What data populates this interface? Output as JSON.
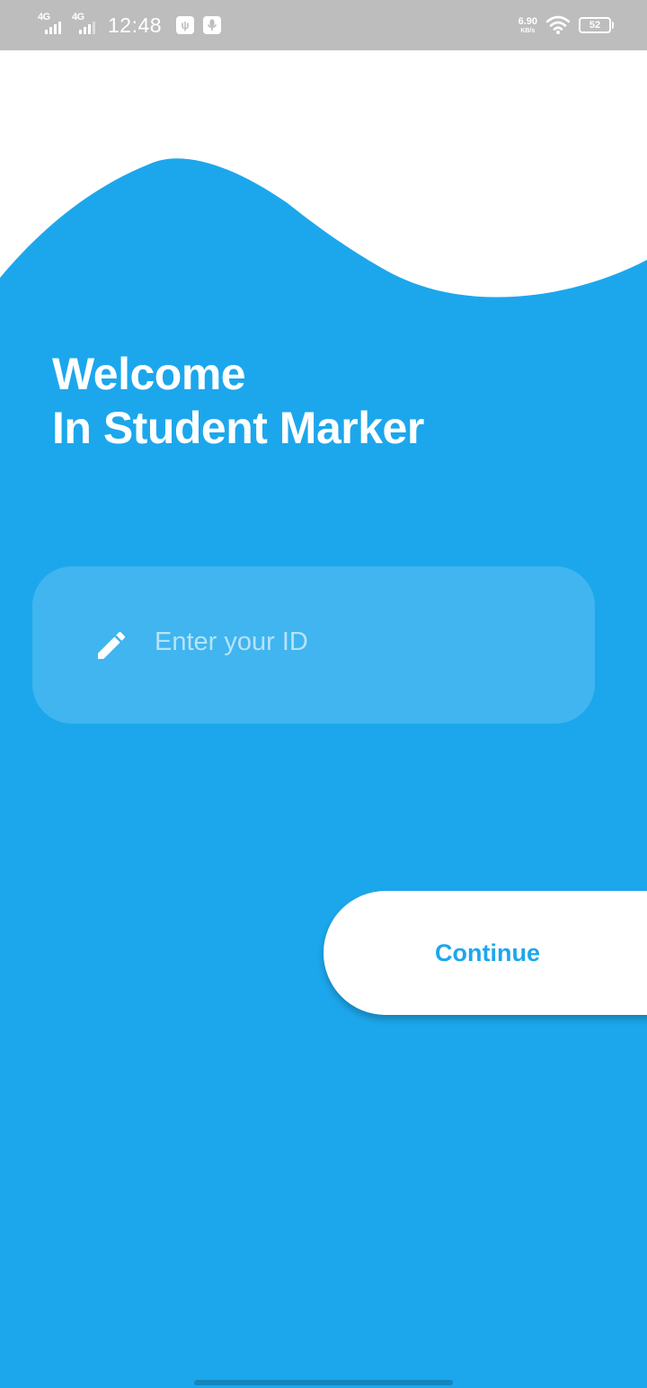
{
  "status_bar": {
    "network_1": "4G",
    "network_2": "4G",
    "time": "12:48",
    "speed_value": "6.90",
    "speed_unit": "KB/s",
    "battery": "52",
    "icons": [
      "signal-icon",
      "usb-icon",
      "mic-icon",
      "wifi-icon",
      "battery-icon"
    ]
  },
  "welcome": {
    "line1": "Welcome",
    "line2": "In Student Marker"
  },
  "id_field": {
    "placeholder": "Enter your ID",
    "value": "",
    "icon": "pencil-icon"
  },
  "continue_button": {
    "label": "Continue"
  },
  "colors": {
    "primary": "#1ca7ec",
    "surface": "#ffffff",
    "status_bar": "#bdbdbd"
  }
}
